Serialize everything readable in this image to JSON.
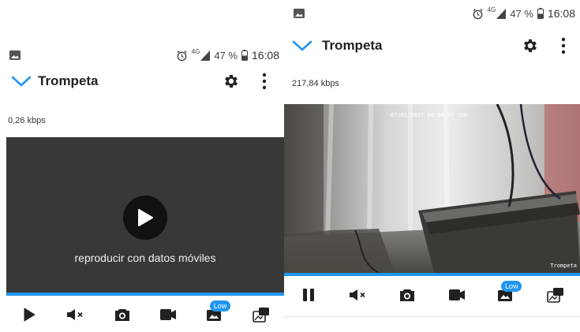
{
  "status": {
    "battery": "47 %",
    "network": "4G",
    "time": "16:08"
  },
  "camera": {
    "name": "Trompeta"
  },
  "left_screen": {
    "bitrate": "0,26 kbps",
    "play_prompt": "reproducir con datos móviles",
    "state": "stopped"
  },
  "right_screen": {
    "bitrate": "217,84 kbps",
    "osd_timestamp": "07/01/2017 08:10:33 SUN",
    "osd_camera_label": "Trompeta",
    "state": "playing"
  },
  "controls": {
    "quality_badge": "Low"
  },
  "colors": {
    "accent": "#2196f3",
    "icon": "#212121",
    "player_background": "#383838"
  },
  "icons": [
    "gallery-icon",
    "alarm-icon",
    "signal-icon",
    "battery-icon",
    "chevron-down-icon",
    "gear-icon",
    "more-vert-icon",
    "play-icon",
    "pause-icon",
    "mute-icon",
    "camera-icon",
    "video-record-icon",
    "quality-icon",
    "switch-icon"
  ]
}
